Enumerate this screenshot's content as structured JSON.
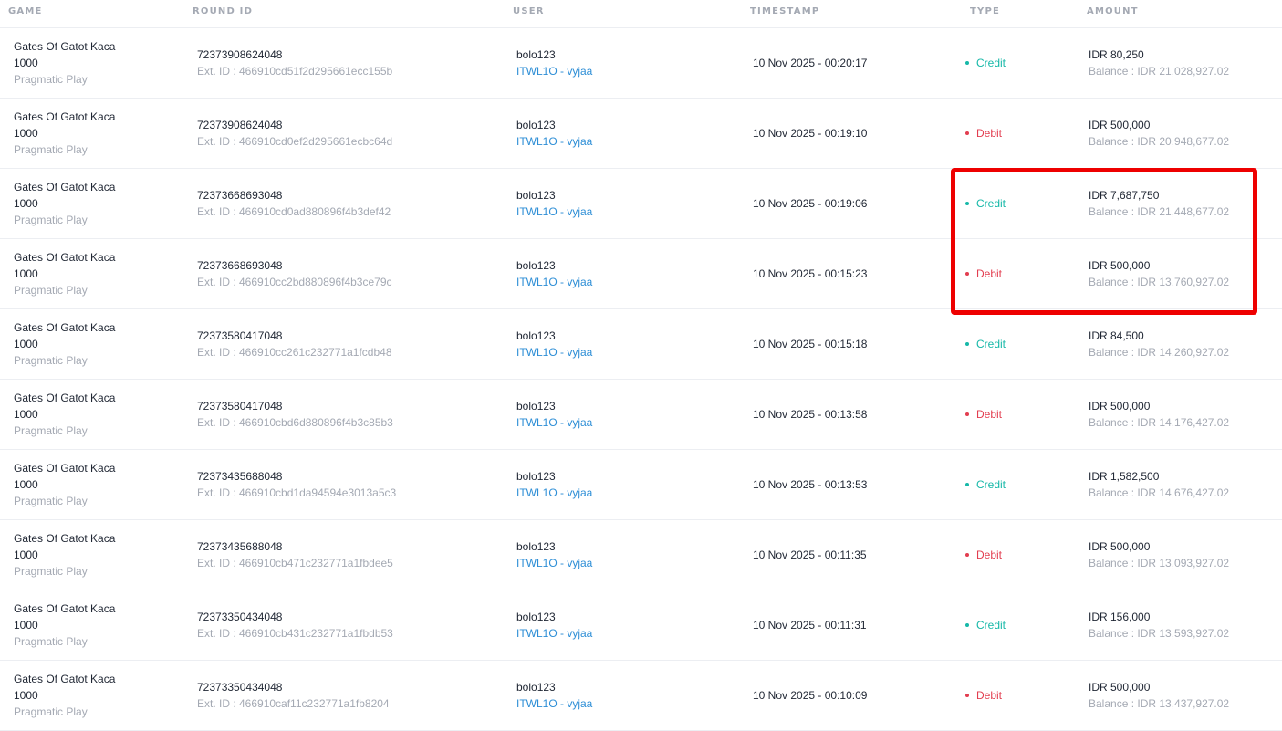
{
  "headers": {
    "game": "GAME",
    "round_id": "ROUND ID",
    "user": "USER",
    "timestamp": "TIMESTAMP",
    "type": "TYPE",
    "amount": "AMOUNT"
  },
  "colors": {
    "credit": "#16b8a8",
    "debit": "#e23d4f",
    "link": "#2d8ed6",
    "muted": "#a4a9b3",
    "highlight": "#ee0000"
  },
  "rows": [
    {
      "game_line1": "Gates Of Gatot Kaca",
      "game_line2": "1000",
      "provider": "Pragmatic Play",
      "round_id": "72373908624048",
      "ext_id": "Ext. ID : 466910cd51f2d295661ecc155b",
      "user": "bolo123",
      "agent": "ITWL1O - vyjaa",
      "timestamp": "10 Nov 2025 - 00:20:17",
      "type": "Credit",
      "amount": "IDR 80,250",
      "balance": "Balance : IDR 21,028,927.02"
    },
    {
      "game_line1": "Gates Of Gatot Kaca",
      "game_line2": "1000",
      "provider": "Pragmatic Play",
      "round_id": "72373908624048",
      "ext_id": "Ext. ID : 466910cd0ef2d295661ecbc64d",
      "user": "bolo123",
      "agent": "ITWL1O - vyjaa",
      "timestamp": "10 Nov 2025 - 00:19:10",
      "type": "Debit",
      "amount": "IDR 500,000",
      "balance": "Balance : IDR 20,948,677.02"
    },
    {
      "game_line1": "Gates Of Gatot Kaca",
      "game_line2": "1000",
      "provider": "Pragmatic Play",
      "round_id": "72373668693048",
      "ext_id": "Ext. ID : 466910cd0ad880896f4b3def42",
      "user": "bolo123",
      "agent": "ITWL1O - vyjaa",
      "timestamp": "10 Nov 2025 - 00:19:06",
      "type": "Credit",
      "amount": "IDR 7,687,750",
      "balance": "Balance : IDR 21,448,677.02"
    },
    {
      "game_line1": "Gates Of Gatot Kaca",
      "game_line2": "1000",
      "provider": "Pragmatic Play",
      "round_id": "72373668693048",
      "ext_id": "Ext. ID : 466910cc2bd880896f4b3ce79c",
      "user": "bolo123",
      "agent": "ITWL1O - vyjaa",
      "timestamp": "10 Nov 2025 - 00:15:23",
      "type": "Debit",
      "amount": "IDR 500,000",
      "balance": "Balance : IDR 13,760,927.02"
    },
    {
      "game_line1": "Gates Of Gatot Kaca",
      "game_line2": "1000",
      "provider": "Pragmatic Play",
      "round_id": "72373580417048",
      "ext_id": "Ext. ID : 466910cc261c232771a1fcdb48",
      "user": "bolo123",
      "agent": "ITWL1O - vyjaa",
      "timestamp": "10 Nov 2025 - 00:15:18",
      "type": "Credit",
      "amount": "IDR 84,500",
      "balance": "Balance : IDR 14,260,927.02"
    },
    {
      "game_line1": "Gates Of Gatot Kaca",
      "game_line2": "1000",
      "provider": "Pragmatic Play",
      "round_id": "72373580417048",
      "ext_id": "Ext. ID : 466910cbd6d880896f4b3c85b3",
      "user": "bolo123",
      "agent": "ITWL1O - vyjaa",
      "timestamp": "10 Nov 2025 - 00:13:58",
      "type": "Debit",
      "amount": "IDR 500,000",
      "balance": "Balance : IDR 14,176,427.02"
    },
    {
      "game_line1": "Gates Of Gatot Kaca",
      "game_line2": "1000",
      "provider": "Pragmatic Play",
      "round_id": "72373435688048",
      "ext_id": "Ext. ID : 466910cbd1da94594e3013a5c3",
      "user": "bolo123",
      "agent": "ITWL1O - vyjaa",
      "timestamp": "10 Nov 2025 - 00:13:53",
      "type": "Credit",
      "amount": "IDR 1,582,500",
      "balance": "Balance : IDR 14,676,427.02"
    },
    {
      "game_line1": "Gates Of Gatot Kaca",
      "game_line2": "1000",
      "provider": "Pragmatic Play",
      "round_id": "72373435688048",
      "ext_id": "Ext. ID : 466910cb471c232771a1fbdee5",
      "user": "bolo123",
      "agent": "ITWL1O - vyjaa",
      "timestamp": "10 Nov 2025 - 00:11:35",
      "type": "Debit",
      "amount": "IDR 500,000",
      "balance": "Balance : IDR 13,093,927.02"
    },
    {
      "game_line1": "Gates Of Gatot Kaca",
      "game_line2": "1000",
      "provider": "Pragmatic Play",
      "round_id": "72373350434048",
      "ext_id": "Ext. ID : 466910cb431c232771a1fbdb53",
      "user": "bolo123",
      "agent": "ITWL1O - vyjaa",
      "timestamp": "10 Nov 2025 - 00:11:31",
      "type": "Credit",
      "amount": "IDR 156,000",
      "balance": "Balance : IDR 13,593,927.02"
    },
    {
      "game_line1": "Gates Of Gatot Kaca",
      "game_line2": "1000",
      "provider": "Pragmatic Play",
      "round_id": "72373350434048",
      "ext_id": "Ext. ID : 466910caf11c232771a1fb8204",
      "user": "bolo123",
      "agent": "ITWL1O - vyjaa",
      "timestamp": "10 Nov 2025 - 00:10:09",
      "type": "Debit",
      "amount": "IDR 500,000",
      "balance": "Balance : IDR 13,437,927.02"
    }
  ]
}
